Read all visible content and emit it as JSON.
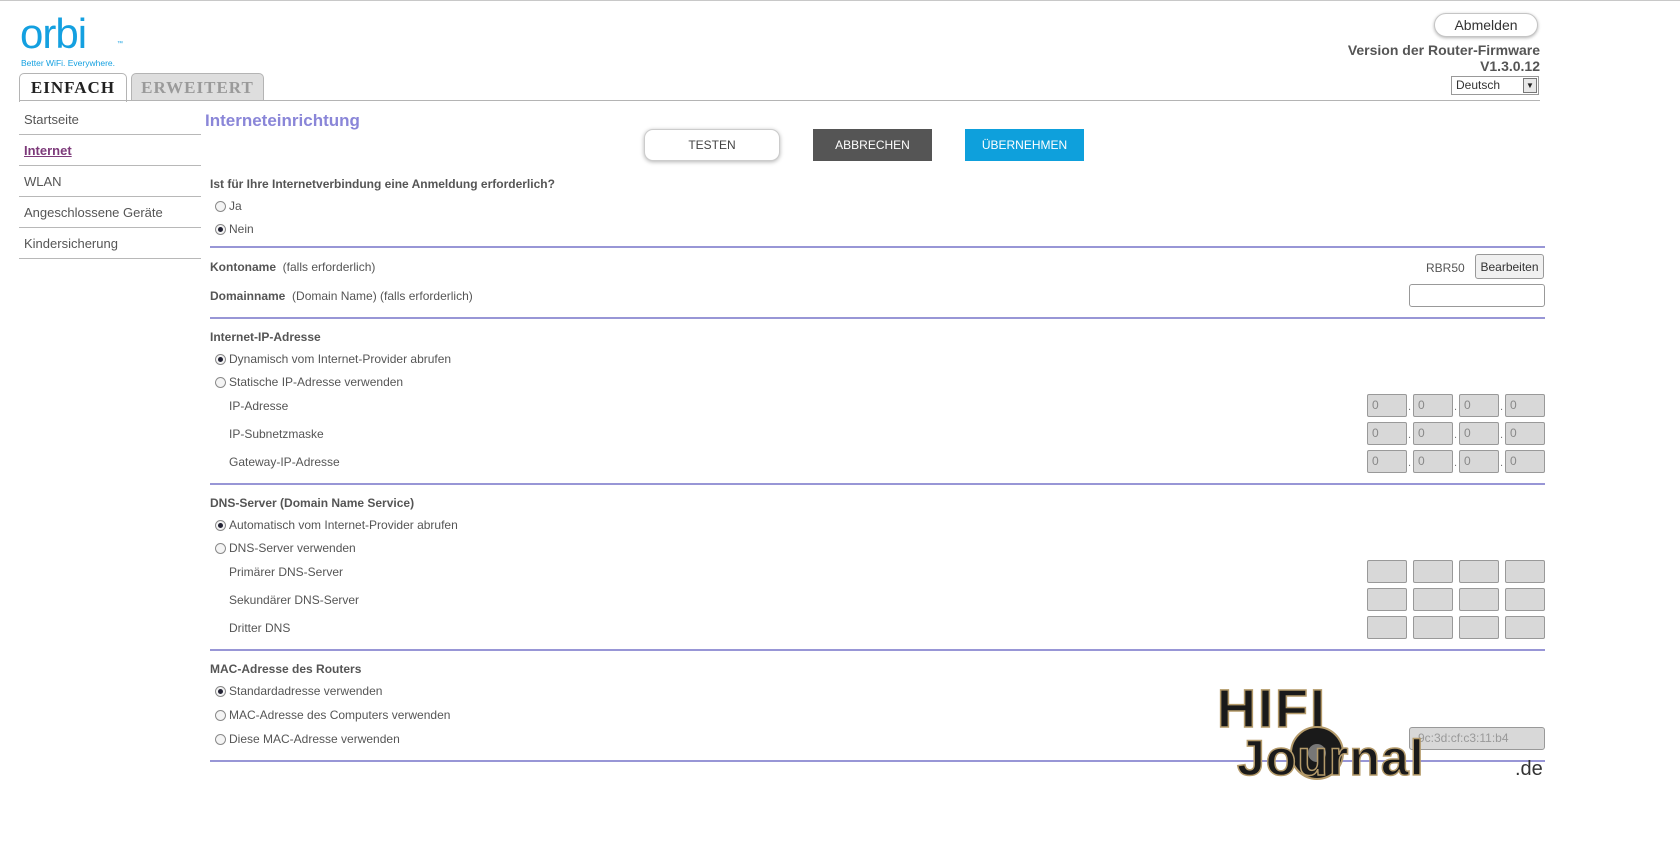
{
  "header": {
    "logo": {
      "brand": "orbi",
      "tm": "™",
      "tagline": "Better WiFi. Everywhere."
    },
    "tabs": [
      {
        "label": "EINFACH"
      },
      {
        "label": "ERWEITERT"
      }
    ],
    "logout_label": "Abmelden",
    "firmware_label": "Version der Router-Firmware",
    "firmware_version": "V1.3.0.12",
    "language": {
      "selected": "Deutsch"
    }
  },
  "sidebar": {
    "items": [
      {
        "label": "Startseite"
      },
      {
        "label": "Internet"
      },
      {
        "label": "WLAN"
      },
      {
        "label": "Angeschlossene Geräte"
      },
      {
        "label": "Kindersicherung"
      }
    ]
  },
  "main": {
    "title": "Interneteinrichtung",
    "buttons": {
      "test": "TESTEN",
      "cancel": "ABBRECHEN",
      "apply": "ÜBERNEHMEN"
    },
    "login_question": "Ist für Ihre Internetverbindung eine Anmeldung erforderlich?",
    "login_options": [
      {
        "label": "Ja"
      },
      {
        "label": "Nein"
      }
    ],
    "account": {
      "label": "Kontoname",
      "hint": "(falls erforderlich)",
      "value": "RBR50",
      "edit_label": "Bearbeiten"
    },
    "domain": {
      "label": "Domainname",
      "hint": "(Domain Name) (falls erforderlich)",
      "value": ""
    },
    "ip_section": {
      "title": "Internet-IP-Adresse",
      "options": [
        {
          "label": "Dynamisch vom Internet-Provider abrufen"
        },
        {
          "label": "Statische IP-Adresse verwenden"
        }
      ],
      "fields": [
        {
          "label": "IP-Adresse",
          "octets": [
            "0",
            "0",
            "0",
            "0"
          ]
        },
        {
          "label": "IP-Subnetzmaske",
          "octets": [
            "0",
            "0",
            "0",
            "0"
          ]
        },
        {
          "label": "Gateway-IP-Adresse",
          "octets": [
            "0",
            "0",
            "0",
            "0"
          ]
        }
      ]
    },
    "dns_section": {
      "title": "DNS-Server (Domain Name Service)",
      "options": [
        {
          "label": "Automatisch vom Internet-Provider abrufen"
        },
        {
          "label": "DNS-Server verwenden"
        }
      ],
      "fields": [
        {
          "label": "Primärer DNS-Server"
        },
        {
          "label": "Sekundärer DNS-Server"
        },
        {
          "label": "Dritter DNS"
        }
      ]
    },
    "mac_section": {
      "title": "MAC-Adresse des Routers",
      "options": [
        {
          "label": "Standardadresse verwenden"
        },
        {
          "label": "MAC-Adresse des Computers verwenden"
        },
        {
          "label": "Diese MAC-Adresse verwenden"
        }
      ],
      "value": "9c:3d:cf:c3:11:b4"
    }
  },
  "watermark": {
    "line1": "HIFI",
    "line2": "Journal",
    "suffix": ".de"
  },
  "colors": {
    "accent": "#9896d6",
    "brand": "#14a0e0",
    "apply": "#0ea0dc",
    "title": "#8a86d8",
    "active_nav": "#7d3a7a"
  }
}
